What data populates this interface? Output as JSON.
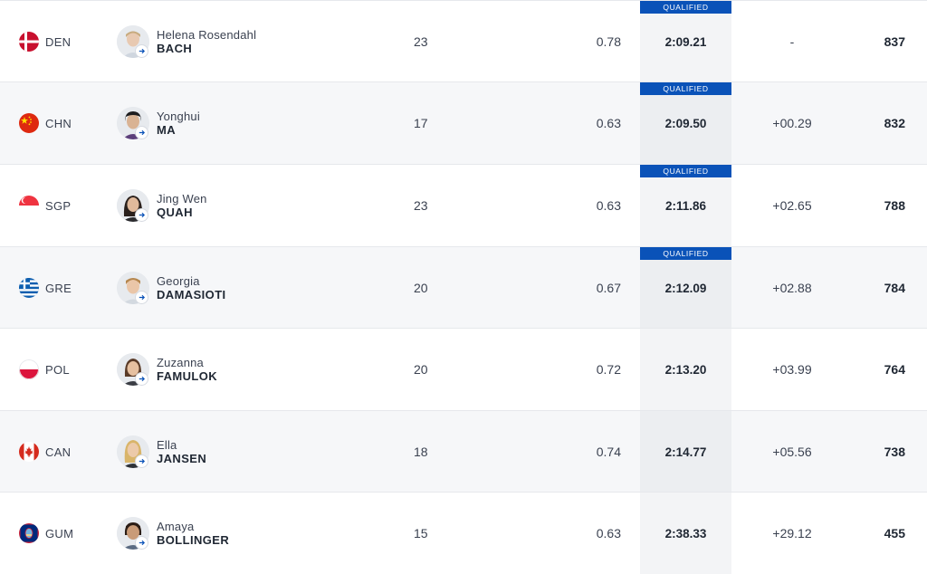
{
  "badge_color": "#0a52b8",
  "rows": [
    {
      "noc": "DEN",
      "flag": "denmark",
      "first_name": "Helena Rosendahl",
      "last_name": "BACH",
      "age": "23",
      "rt": "0.78",
      "result": "2:09.21",
      "diff": "-",
      "points": "837",
      "badge": "QUALIFIED",
      "alt": false
    },
    {
      "noc": "CHN",
      "flag": "china",
      "first_name": "Yonghui",
      "last_name": "MA",
      "age": "17",
      "rt": "0.63",
      "result": "2:09.50",
      "diff": "+00.29",
      "points": "832",
      "badge": "QUALIFIED",
      "alt": true
    },
    {
      "noc": "SGP",
      "flag": "singapore",
      "first_name": "Jing Wen",
      "last_name": "QUAH",
      "age": "23",
      "rt": "0.63",
      "result": "2:11.86",
      "diff": "+02.65",
      "points": "788",
      "badge": "QUALIFIED",
      "alt": false
    },
    {
      "noc": "GRE",
      "flag": "greece",
      "first_name": "Georgia",
      "last_name": "DAMASIOTI",
      "age": "20",
      "rt": "0.67",
      "result": "2:12.09",
      "diff": "+02.88",
      "points": "784",
      "badge": "QUALIFIED",
      "alt": true
    },
    {
      "noc": "POL",
      "flag": "poland",
      "first_name": "Zuzanna",
      "last_name": "FAMULOK",
      "age": "20",
      "rt": "0.72",
      "result": "2:13.20",
      "diff": "+03.99",
      "points": "764",
      "badge": "",
      "alt": false
    },
    {
      "noc": "CAN",
      "flag": "canada",
      "first_name": "Ella",
      "last_name": "JANSEN",
      "age": "18",
      "rt": "0.74",
      "result": "2:14.77",
      "diff": "+05.56",
      "points": "738",
      "badge": "",
      "alt": true
    },
    {
      "noc": "GUM",
      "flag": "guam",
      "first_name": "Amaya",
      "last_name": "BOLLINGER",
      "age": "15",
      "rt": "0.63",
      "result": "2:38.33",
      "diff": "+29.12",
      "points": "455",
      "badge": "",
      "alt": false
    }
  ]
}
